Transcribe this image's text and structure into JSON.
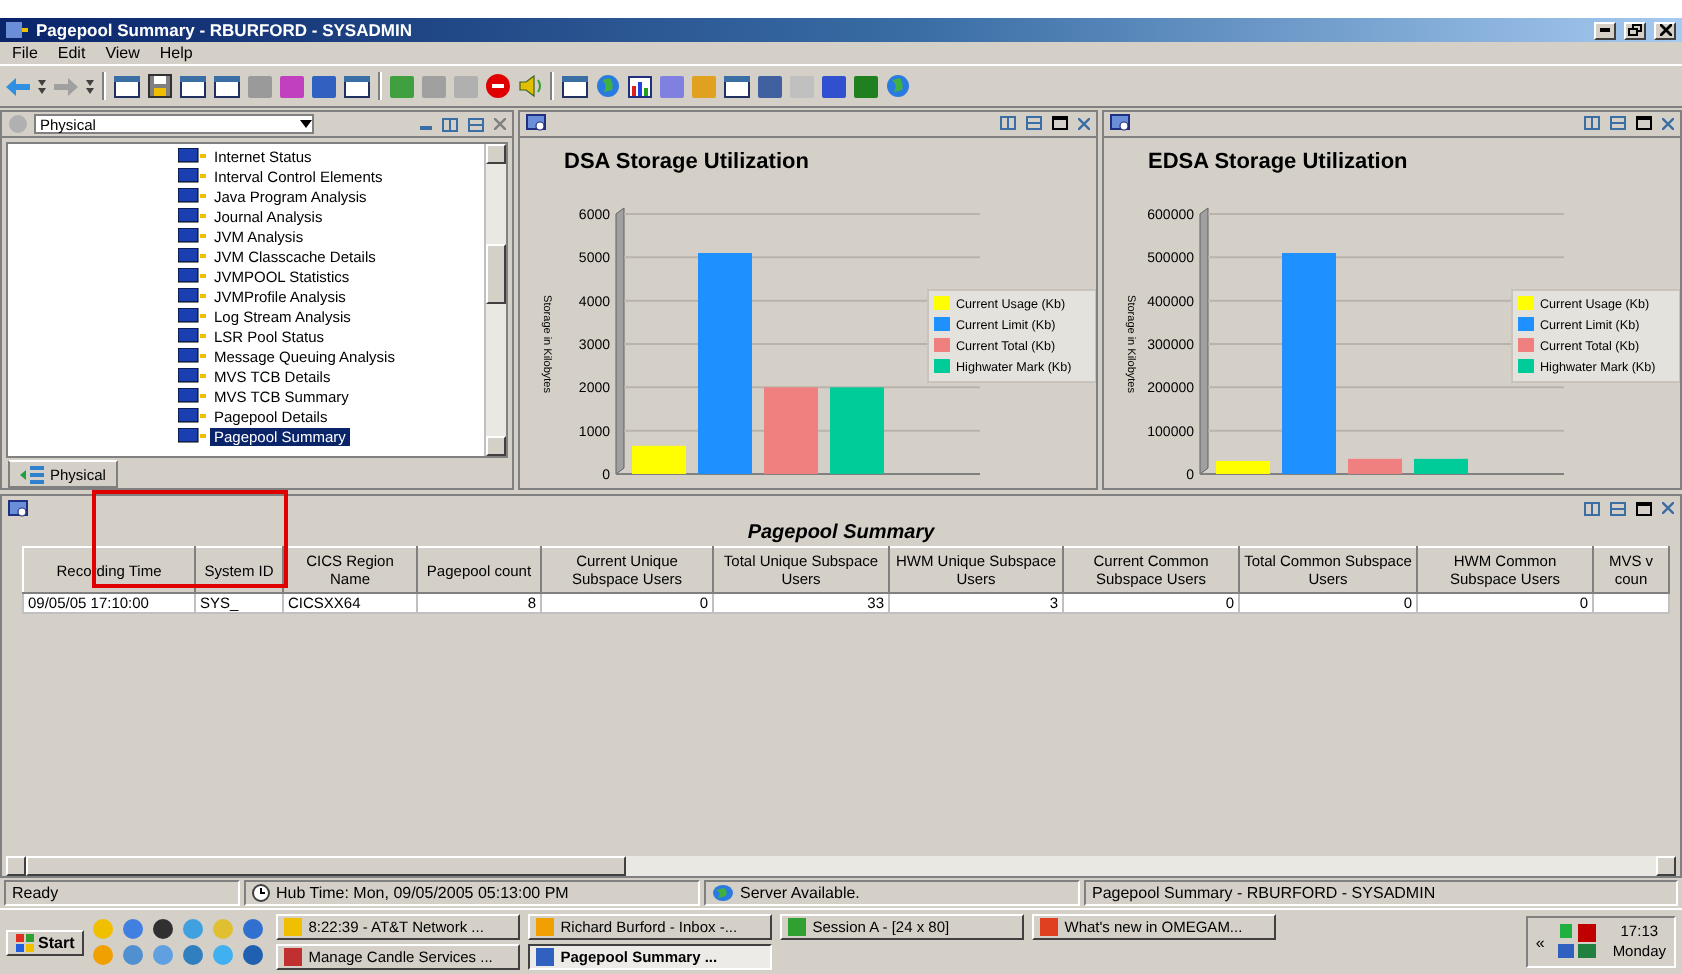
{
  "window": {
    "title": "Pagepool Summary - RBURFORD - SYSADMIN"
  },
  "menu": [
    "File",
    "Edit",
    "View",
    "Help"
  ],
  "toolbar": [
    {
      "kind": "back"
    },
    {
      "kind": "dropdown"
    },
    {
      "kind": "forward"
    },
    {
      "kind": "dropdown"
    },
    {
      "kind": "separator"
    },
    {
      "kind": "window"
    },
    {
      "kind": "disk"
    },
    {
      "kind": "window"
    },
    {
      "kind": "window"
    },
    {
      "kind": "generic",
      "color": "#9a9a9a"
    },
    {
      "kind": "generic",
      "color": "#c040c0"
    },
    {
      "kind": "generic",
      "color": "#3060c0"
    },
    {
      "kind": "window"
    },
    {
      "kind": "separator"
    },
    {
      "kind": "generic",
      "color": "#40a040"
    },
    {
      "kind": "generic",
      "color": "#a0a0a0"
    },
    {
      "kind": "generic",
      "color": "#b0b0b0"
    },
    {
      "kind": "stop"
    },
    {
      "kind": "speaker"
    },
    {
      "kind": "separator"
    },
    {
      "kind": "window"
    },
    {
      "kind": "globe"
    },
    {
      "kind": "bars"
    },
    {
      "kind": "generic",
      "color": "#8080e0"
    },
    {
      "kind": "generic",
      "color": "#e0a020"
    },
    {
      "kind": "window"
    },
    {
      "kind": "generic",
      "color": "#4060a0"
    },
    {
      "kind": "generic",
      "color": "#c0c0c0"
    },
    {
      "kind": "generic",
      "color": "#3050d0"
    },
    {
      "kind": "generic",
      "color": "#208020"
    },
    {
      "kind": "globe"
    }
  ],
  "navigator": {
    "view": "Physical",
    "tab": "Physical",
    "items": [
      {
        "label": "Internet Status",
        "selected": false
      },
      {
        "label": "Interval Control Elements",
        "selected": false
      },
      {
        "label": "Java Program Analysis",
        "selected": false
      },
      {
        "label": "Journal Analysis",
        "selected": false
      },
      {
        "label": "JVM Analysis",
        "selected": false
      },
      {
        "label": "JVM Classcache Details",
        "selected": false
      },
      {
        "label": "JVMPOOL Statistics",
        "selected": false
      },
      {
        "label": "JVMProfile Analysis",
        "selected": false
      },
      {
        "label": "Log Stream Analysis",
        "selected": false
      },
      {
        "label": "LSR Pool Status",
        "selected": false
      },
      {
        "label": "Message Queuing Analysis",
        "selected": false
      },
      {
        "label": "MVS TCB Details",
        "selected": false
      },
      {
        "label": "MVS TCB Summary",
        "selected": false
      },
      {
        "label": "Pagepool Details",
        "selected": false
      },
      {
        "label": "Pagepool Summary",
        "selected": true
      }
    ]
  },
  "charts": [
    {
      "chart_data": {
        "type": "bar",
        "grid": true,
        "legend": true,
        "title": "DSA Storage Utilization",
        "ylabel": "Storage in Kilobytes",
        "ylim": [
          0,
          6000
        ],
        "yticks": [
          0,
          1000,
          2000,
          3000,
          4000,
          5000,
          6000
        ],
        "series": [
          {
            "name": "Current Usage (Kb)",
            "color": "#ffff00",
            "values": [
              650
            ]
          },
          {
            "name": "Current Limit (Kb)",
            "color": "#1e90ff",
            "values": [
              5100
            ]
          },
          {
            "name": "Current Total (Kb)",
            "color": "#f08080",
            "values": [
              2000
            ]
          },
          {
            "name": "Highwater Mark (Kb)",
            "color": "#00cc99",
            "values": [
              2000
            ]
          }
        ]
      }
    },
    {
      "chart_data": {
        "type": "bar",
        "grid": true,
        "legend": true,
        "title": "EDSA Storage Utilization",
        "ylabel": "Storage in Kilobytes",
        "ylim": [
          0,
          600000
        ],
        "yticks": [
          0,
          100000,
          200000,
          300000,
          400000,
          500000,
          600000
        ],
        "series": [
          {
            "name": "Current Usage (Kb)",
            "color": "#ffff00",
            "values": [
              30000
            ]
          },
          {
            "name": "Current Limit (Kb)",
            "color": "#1e90ff",
            "values": [
              510000
            ]
          },
          {
            "name": "Current Total (Kb)",
            "color": "#f08080",
            "values": [
              35000
            ]
          },
          {
            "name": "Highwater Mark (Kb)",
            "color": "#00cc99",
            "values": [
              35000
            ]
          }
        ]
      }
    }
  ],
  "table": {
    "title": "Pagepool Summary",
    "columns": [
      "Recording Time",
      "System ID",
      "CICS Region Name",
      "Pagepool count",
      "Current Unique Subspace Users",
      "Total Unique Subspace Users",
      "HWM Unique Subspace Users",
      "Current Common Subspace Users",
      "Total Common Subspace Users",
      "HWM Common Subspace Users",
      "MVS v coun"
    ],
    "rows": [
      [
        "09/05/05 17:10:00",
        "SYS_",
        "CICSXX64",
        "8",
        "0",
        "33",
        "3",
        "0",
        "0",
        "0",
        ""
      ]
    ]
  },
  "status_bar": {
    "message": "Ready",
    "hub_time": "Hub Time: Mon, 09/05/2005 05:13:00 PM",
    "server": "Server Available.",
    "context": "Pagepool Summary - RBURFORD - SYSADMIN"
  },
  "taskbar": {
    "start": "Start",
    "quick_launch": [
      {
        "color": "#f0c000"
      },
      {
        "color": "#4080e0"
      },
      {
        "color": "#303030"
      },
      {
        "color": "#40a0e0"
      },
      {
        "color": "#e0c030"
      },
      {
        "color": "#3070d0"
      },
      {
        "color": "#f0a000"
      },
      {
        "color": "#5090d0"
      },
      {
        "color": "#60a0e0"
      },
      {
        "color": "#3080c0"
      },
      {
        "color": "#40b0f0"
      },
      {
        "color": "#2060b0"
      }
    ],
    "tasks": [
      {
        "label": "8:22:39 - AT&T Network ...",
        "selected": false,
        "color": "#f0c000"
      },
      {
        "label": "Richard Burford - Inbox -...",
        "selected": false,
        "color": "#f0a000"
      },
      {
        "label": "Session A - [24 x 80]",
        "selected": false,
        "color": "#30a030"
      },
      {
        "label": "What's new in OMEGAM...",
        "selected": false,
        "color": "#e04020"
      },
      {
        "label": "Manage Candle Services ...",
        "selected": false,
        "color": "#c03030"
      },
      {
        "label": "Pagepool Summary ...",
        "selected": true,
        "color": "#3060c0"
      }
    ],
    "tray_expand": "«",
    "time": "17:13",
    "day": "Monday"
  }
}
